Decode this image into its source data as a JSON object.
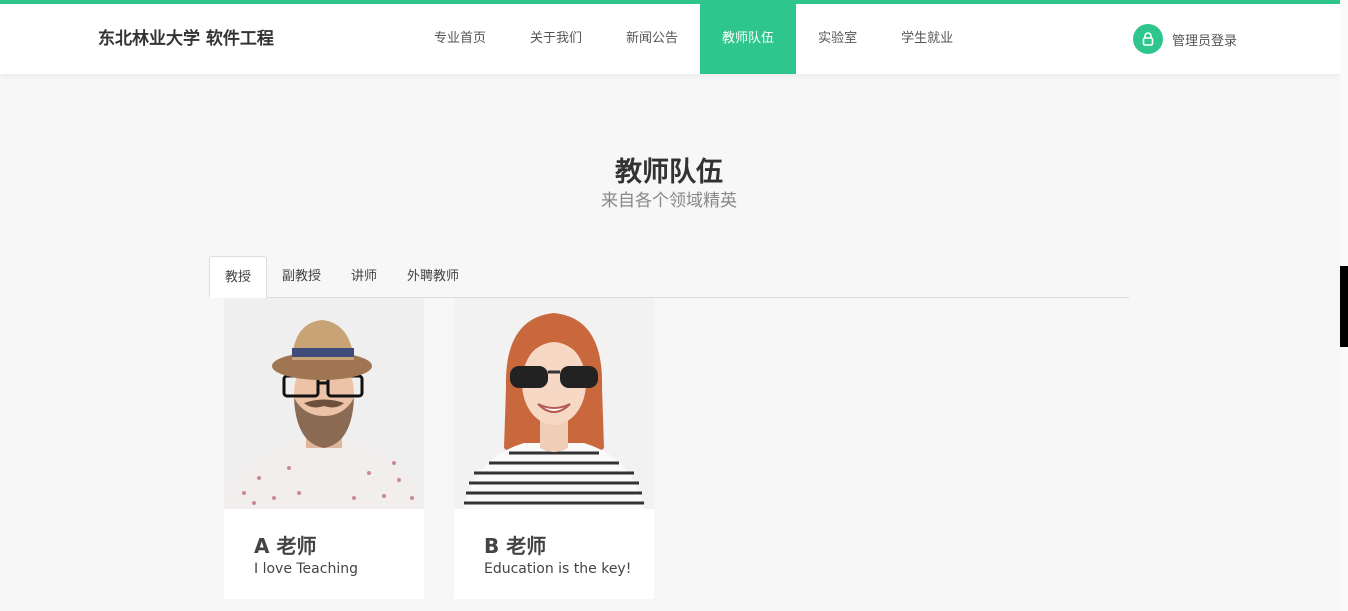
{
  "header": {
    "logo": "东北林业大学 软件工程",
    "nav": [
      {
        "label": "专业首页"
      },
      {
        "label": "关于我们"
      },
      {
        "label": "新闻公告"
      },
      {
        "label": "教师队伍",
        "active": true
      },
      {
        "label": "实验室"
      },
      {
        "label": "学生就业"
      }
    ],
    "login_label": "管理员登录",
    "login_icon": "user-lock-icon"
  },
  "colors": {
    "accent": "#2ec68c",
    "background": "#f7f7f7"
  },
  "section": {
    "title": "教师队伍",
    "subtitle": "来自各个领域精英"
  },
  "tabs": [
    {
      "label": "教授",
      "active": true
    },
    {
      "label": "副教授"
    },
    {
      "label": "讲师"
    },
    {
      "label": "外聘教师"
    }
  ],
  "teachers": [
    {
      "name": "A 老师",
      "motto": "I love Teaching"
    },
    {
      "name": "B 老师",
      "motto": "Education is the key!"
    }
  ]
}
